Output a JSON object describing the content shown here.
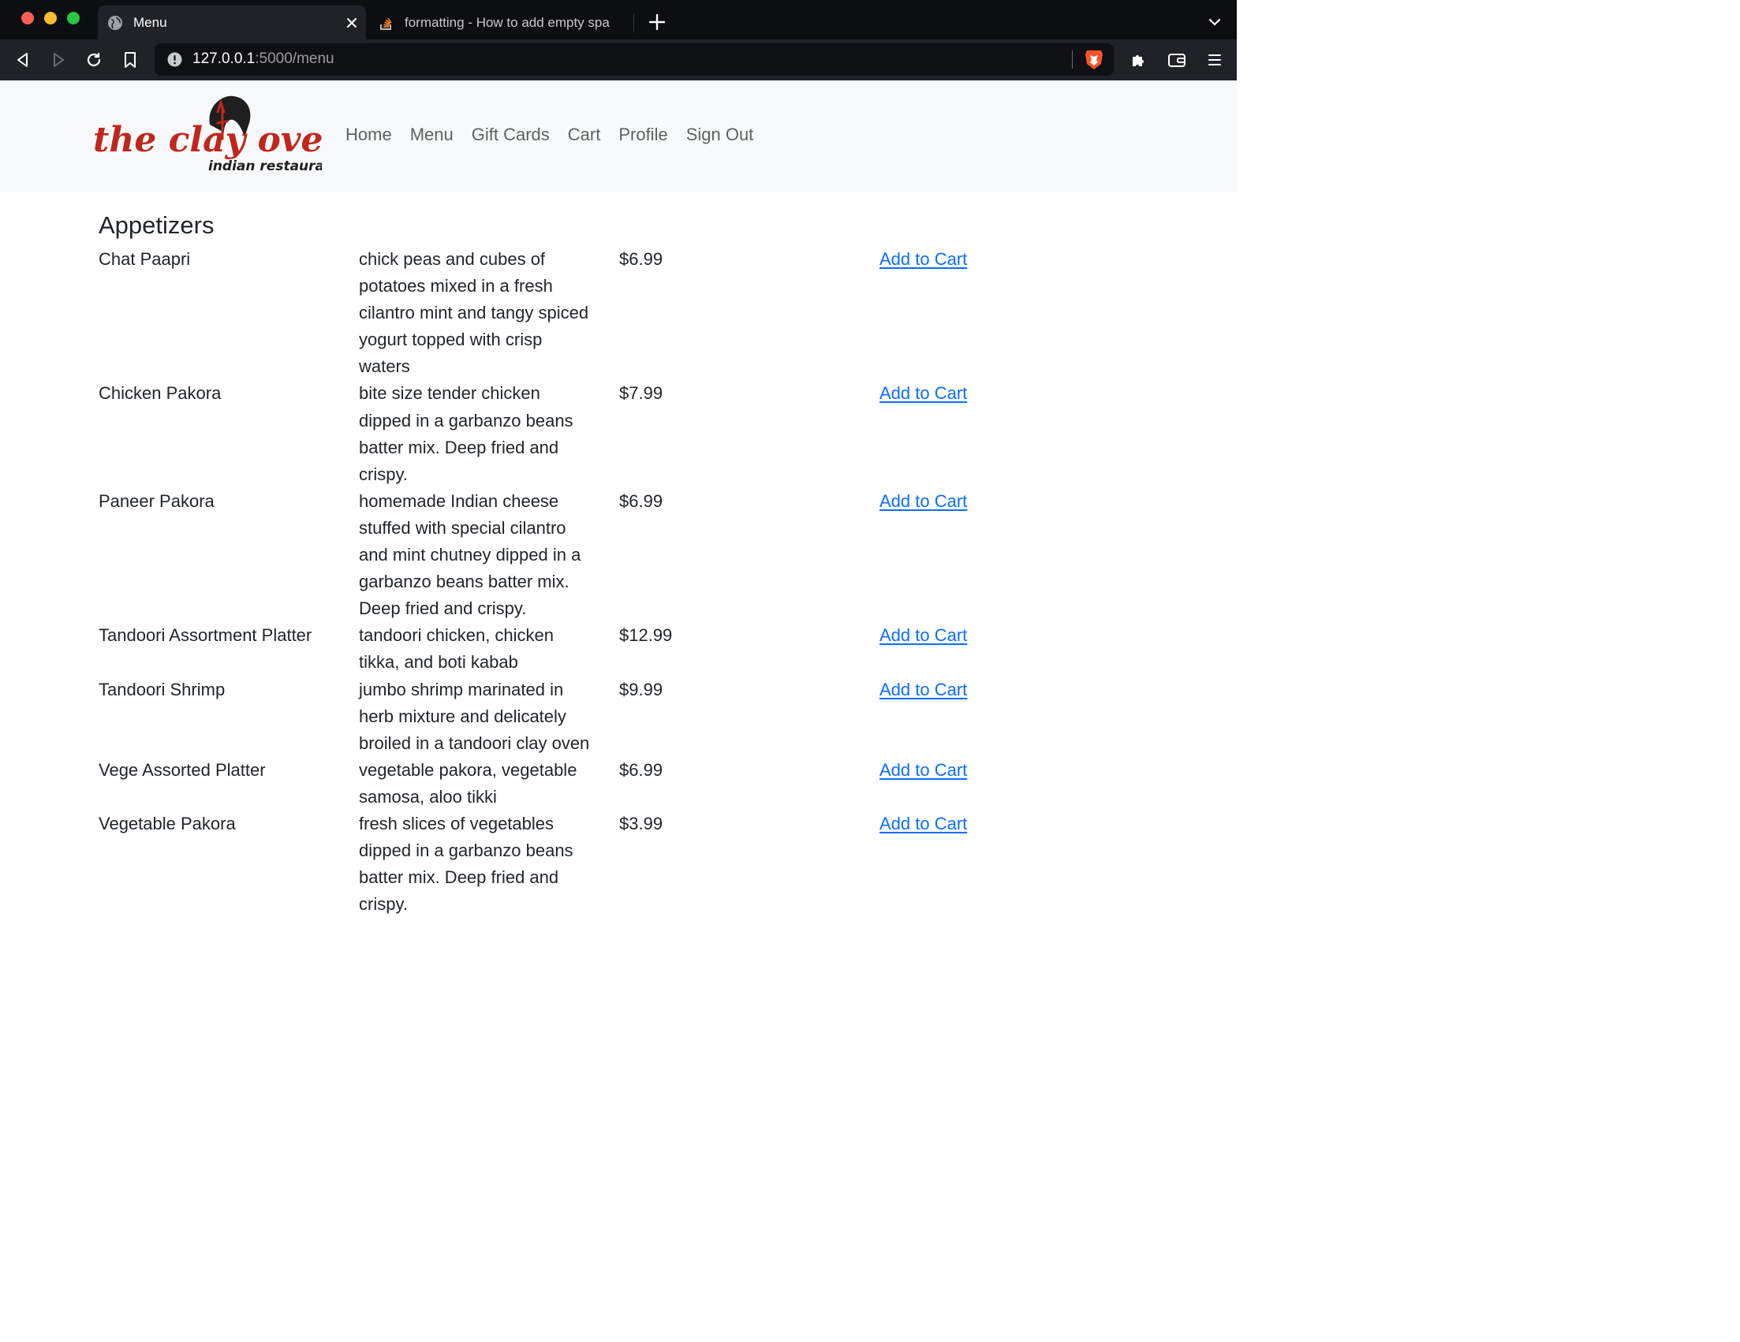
{
  "browser": {
    "tabs": [
      {
        "title": "Menu",
        "active": true
      },
      {
        "title": "formatting - How to add empty spa",
        "active": false
      }
    ],
    "url": {
      "host": "127.0.0.1",
      "path": ":5000/menu"
    }
  },
  "colors": {
    "brand_red": "#c0271c",
    "brand_dark": "#1f1f1f",
    "link": "#0d6efd"
  },
  "site": {
    "logo": {
      "line1": "the clay oven",
      "line2": "indian restaurant"
    },
    "nav": [
      {
        "label": "Home"
      },
      {
        "label": "Menu"
      },
      {
        "label": "Gift Cards"
      },
      {
        "label": "Cart"
      },
      {
        "label": "Profile"
      },
      {
        "label": "Sign Out"
      }
    ]
  },
  "menu": {
    "section_title": "Appetizers",
    "action_label": "Add to Cart",
    "items": [
      {
        "name": "Chat Paapri",
        "description": "chick peas and cubes of potatoes mixed in a fresh cilantro mint and tangy spiced yogurt topped with crisp waters",
        "price": "$6.99"
      },
      {
        "name": "Chicken Pakora",
        "description": "bite size tender chicken dipped in a garbanzo beans batter mix. Deep fried and crispy.",
        "price": "$7.99"
      },
      {
        "name": "Paneer Pakora",
        "description": "homemade Indian cheese stuffed with special cilantro and mint chutney dipped in a garbanzo beans batter mix. Deep fried and crispy.",
        "price": "$6.99"
      },
      {
        "name": "Tandoori Assortment Platter",
        "description": "tandoori chicken, chicken tikka, and boti kabab",
        "price": "$12.99"
      },
      {
        "name": "Tandoori Shrimp",
        "description": "jumbo shrimp marinated in herb mixture and delicately broiled in a tandoori clay oven",
        "price": "$9.99"
      },
      {
        "name": "Vege Assorted Platter",
        "description": "vegetable pakora, vegetable samosa, aloo tikki",
        "price": "$6.99"
      },
      {
        "name": "Vegetable Pakora",
        "description": "fresh slices of vegetables dipped in a garbanzo beans batter mix. Deep fried and crispy.",
        "price": "$3.99"
      }
    ]
  }
}
